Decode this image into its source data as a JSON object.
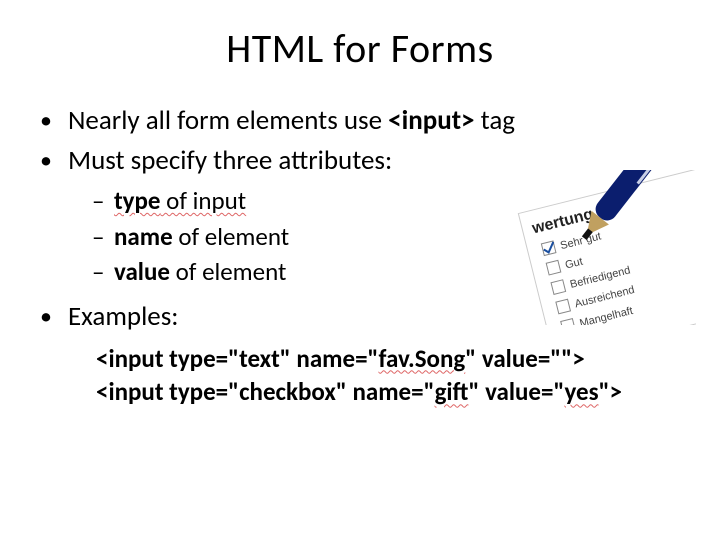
{
  "title": "HTML for Forms",
  "b1_pre": "Nearly all form elements use ",
  "b1_bold": "<input>",
  "b1_post": " tag",
  "b2": "Must specify three attributes:",
  "s1_bold": "type",
  "s1_post": " of input",
  "s2_bold": "name",
  "s2_post": " of element",
  "s3_bold": "value",
  "s3_post": " of element",
  "b3": "Examples:",
  "ex1_a": "<input type=\"text\" name=\"",
  "ex1_w": "fav.Song",
  "ex1_b": "\" value=\"\">",
  "ex2_a": "<input type=\"checkbox\" name=\"",
  "ex2_w": "gift",
  "ex2_b": "\" value=\"",
  "ex2_v": "yes",
  "ex2_c": "\">",
  "graphic": {
    "heading": "wertung",
    "rows": [
      "Sehr gut",
      "Gut",
      "Befriedigend",
      "Ausreichend",
      "Mangelhaft"
    ]
  }
}
